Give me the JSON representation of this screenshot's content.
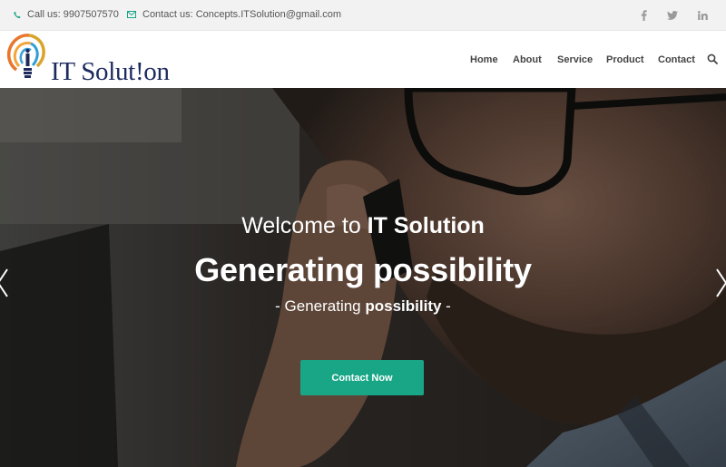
{
  "topbar": {
    "phone_text": "Call us: 9907507570",
    "email_text": "Contact us: Concepts.ITSolution@gmail.com",
    "phone_icon": "phone-icon",
    "email_icon": "mail-icon",
    "social": [
      "facebook-icon",
      "twitter-icon",
      "linkedin-icon"
    ]
  },
  "header": {
    "logo_text": "IT Solut!on",
    "nav": {
      "home": "Home",
      "about": "About",
      "service": "Service",
      "product": "Product",
      "contact": "Contact"
    },
    "search_icon": "search-icon"
  },
  "hero": {
    "welcome_prefix": "Welcome to ",
    "welcome_brand": "IT Solution",
    "title": "Generating possibility",
    "sub_prefix": "- Generating ",
    "sub_bold": "possibility",
    "sub_suffix": " -",
    "cta_label": "Contact Now",
    "prev_icon": "chevron-left-icon",
    "next_icon": "chevron-right-icon"
  },
  "colors": {
    "accent": "#19a686",
    "logo_navy": "#1c2a5e",
    "topbar_bg": "#f2f2f2"
  }
}
